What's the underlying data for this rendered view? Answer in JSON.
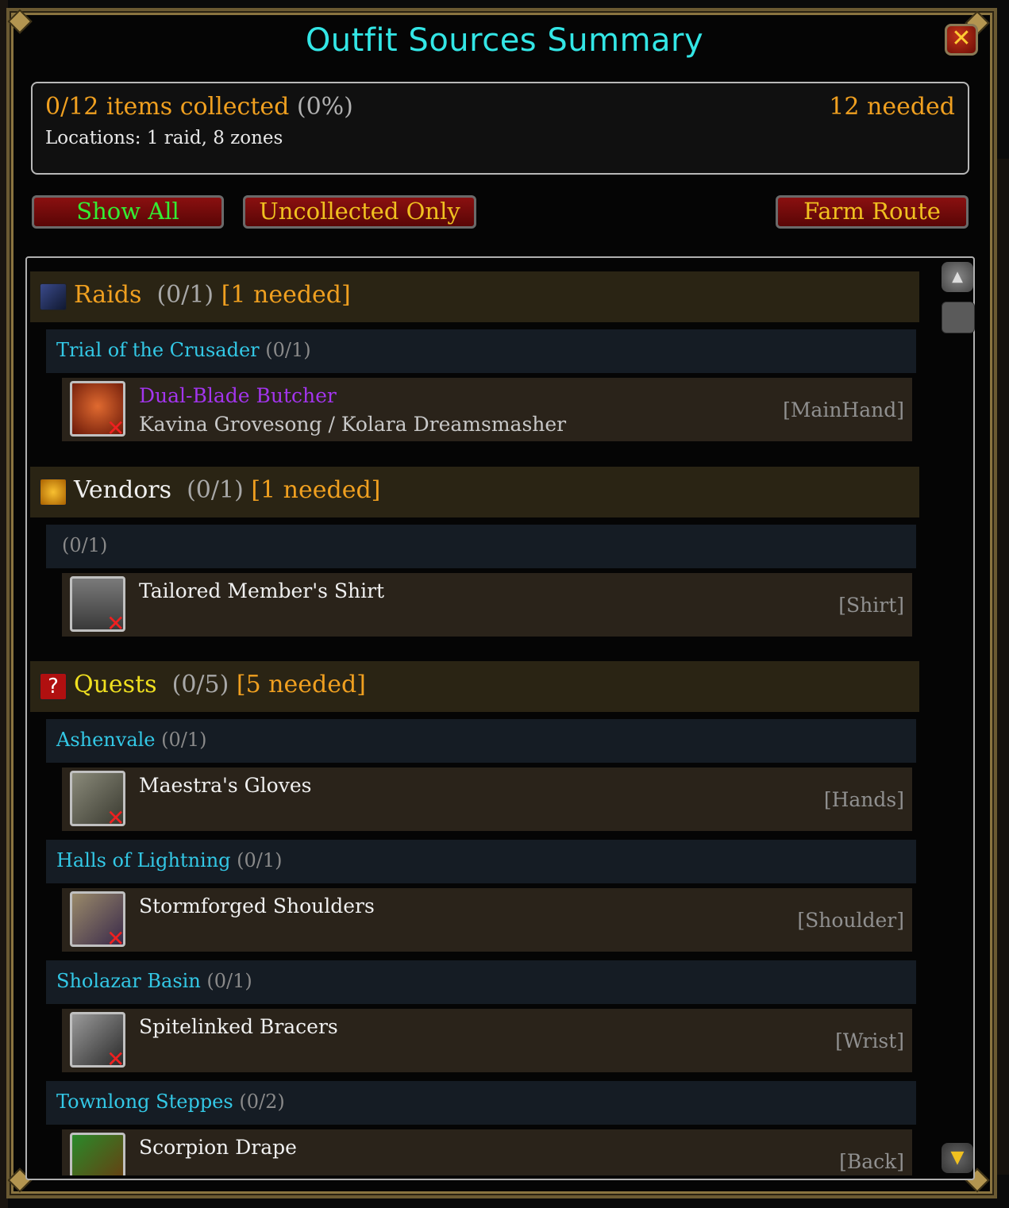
{
  "window": {
    "title": "Outfit Sources Summary",
    "close_label": "✕"
  },
  "summary": {
    "collected": "0/12 items collected",
    "percent": "(0%)",
    "needed": "12 needed",
    "locations": "Locations: 1 raid, 8 zones"
  },
  "filters": {
    "show_all": "Show All",
    "uncollected_only": "Uncollected Only",
    "farm_route": "Farm Route"
  },
  "categories": {
    "raids": {
      "name": "Raids",
      "count": "(0/1)",
      "needed": "[1 needed]",
      "color": "#f0a020"
    },
    "vendors": {
      "name": "Vendors",
      "count": "(0/1)",
      "needed": "[1 needed]",
      "color": "#f0f0f0"
    },
    "quests": {
      "name": "Quests",
      "count": "(0/5)",
      "needed": "[5 needed]",
      "color": "#f0e020"
    }
  },
  "zones": {
    "totc": {
      "name": "Trial of the Crusader",
      "count": "(0/1)"
    },
    "vendor_none": {
      "name": "",
      "count": "(0/1)"
    },
    "ashenvale": {
      "name": "Ashenvale",
      "count": "(0/1)"
    },
    "halls": {
      "name": "Halls of Lightning",
      "count": "(0/1)"
    },
    "sholazar": {
      "name": "Sholazar Basin",
      "count": "(0/1)"
    },
    "townlong": {
      "name": "Townlong Steppes",
      "count": "(0/2)"
    }
  },
  "items": {
    "butcher": {
      "name": "Dual-Blade Butcher",
      "source": "Kavina Grovesong / Kolara Dreamsmasher",
      "slot": "[MainHand]",
      "quality_color": "#a335ee",
      "icon": "dual-blade-icon"
    },
    "shirt": {
      "name": "Tailored Member's Shirt",
      "source": "",
      "slot": "[Shirt]",
      "icon": "shirt-icon"
    },
    "gloves": {
      "name": "Maestra's Gloves",
      "source": "",
      "slot": "[Hands]",
      "icon": "gloves-icon"
    },
    "shoulders": {
      "name": "Stormforged Shoulders",
      "source": "",
      "slot": "[Shoulder]",
      "icon": "shoulders-icon"
    },
    "bracers": {
      "name": "Spitelinked Bracers",
      "source": "",
      "slot": "[Wrist]",
      "icon": "bracers-icon"
    },
    "drape": {
      "name": "Scorpion Drape",
      "source": "",
      "slot": "[Back]",
      "icon": "cloak-icon"
    }
  },
  "colors": {
    "accent_cyan": "#33e6e6",
    "gold": "#f0a020",
    "uncollected_x": "#ee2020"
  }
}
